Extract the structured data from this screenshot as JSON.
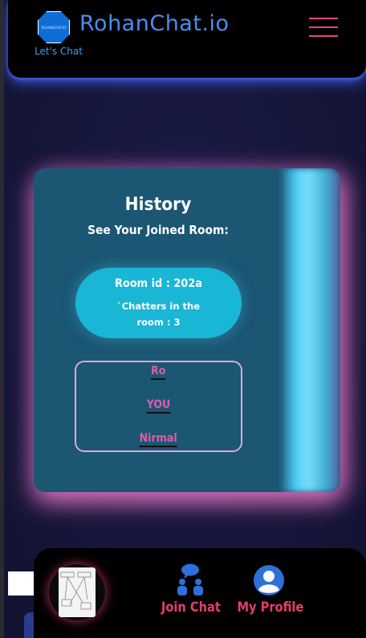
{
  "header": {
    "brand": "RohanChat.io",
    "tagline": "Let's Chat",
    "logo_text": "ROHANCHAT.IO"
  },
  "history": {
    "title": "History",
    "subtitle": "See Your Joined Room:",
    "room": {
      "id_label": "Room id : 202a",
      "chatters_label": "`Chatters in the room : 3"
    },
    "members": [
      "Ro",
      "YOU",
      "Nirmal"
    ]
  },
  "bottom_nav": {
    "join_label": "Join Chat",
    "profile_label": "My Profile"
  },
  "colors": {
    "accent_pink": "#e63d6e",
    "brand_blue": "#4b8df0",
    "card_bg": "#1b5673",
    "pill_bg": "#1ab6d6"
  },
  "icons": {
    "menu": "hamburger-menu-icon",
    "join": "chat-people-icon",
    "profile": "user-circle-icon"
  }
}
